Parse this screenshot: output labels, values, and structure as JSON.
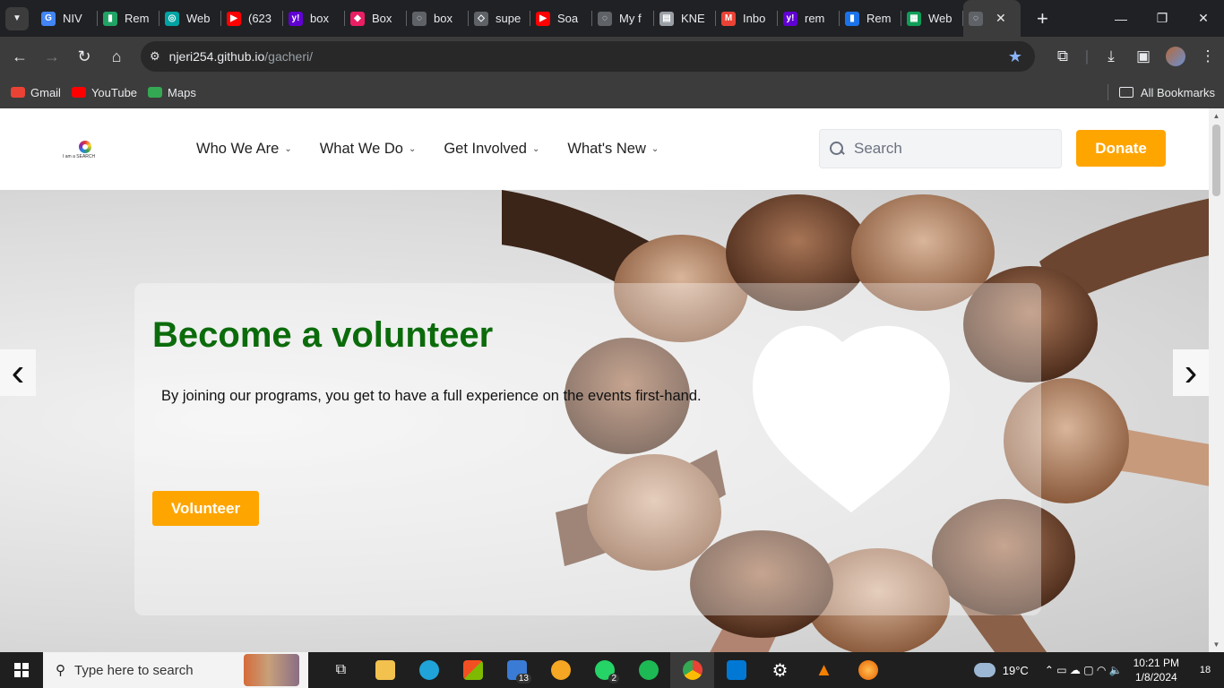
{
  "browser": {
    "tabs": [
      {
        "label": "NIV",
        "color": "#4285f4",
        "glyph": "G"
      },
      {
        "label": "Rem",
        "color": "#21a366",
        "glyph": "▮"
      },
      {
        "label": "Web",
        "color": "#00a3a3",
        "glyph": "◎"
      },
      {
        "label": "(623",
        "color": "#ff0000",
        "glyph": "▶"
      },
      {
        "label": "box",
        "color": "#6001d2",
        "glyph": "y!"
      },
      {
        "label": "Box",
        "color": "#e91e63",
        "glyph": "◆"
      },
      {
        "label": "box",
        "color": "#5f6368",
        "glyph": "◌"
      },
      {
        "label": "supe",
        "color": "#5f6368",
        "glyph": "◇"
      },
      {
        "label": "Soa",
        "color": "#ff0000",
        "glyph": "▶"
      },
      {
        "label": "My f",
        "color": "#5f6368",
        "glyph": "◌"
      },
      {
        "label": "KNE",
        "color": "#9aa0a6",
        "glyph": "▤"
      },
      {
        "label": "Inbo",
        "color": "#ea4335",
        "glyph": "M"
      },
      {
        "label": "rem",
        "color": "#6001d2",
        "glyph": "y!"
      },
      {
        "label": "Rem",
        "color": "#1a73e8",
        "glyph": "▮"
      },
      {
        "label": "Web",
        "color": "#0f9d58",
        "glyph": "▦"
      }
    ],
    "active_tab": {
      "label": "",
      "glyph": "◌"
    },
    "close_label": "✕",
    "new_tab_label": "+",
    "window_controls": {
      "minimize": "—",
      "maximize": "❐",
      "close": "✕"
    },
    "url": {
      "host": "njeri254.github.io",
      "path": "/gacheri/"
    },
    "bookmarks": [
      {
        "label": "Gmail",
        "color": "#ea4335"
      },
      {
        "label": "YouTube",
        "color": "#ff0000"
      },
      {
        "label": "Maps",
        "color": "#34a853"
      }
    ],
    "all_bookmarks_label": "All Bookmarks"
  },
  "site": {
    "logo_text": "I am a SEARCH",
    "menu": [
      {
        "label": "Who We Are"
      },
      {
        "label": "What We Do"
      },
      {
        "label": "Get Involved"
      },
      {
        "label": "What's New"
      }
    ],
    "search_placeholder": "Search",
    "donate_label": "Donate",
    "hero": {
      "title": "Become a volunteer",
      "text": "By joining our programs, you get to have a full experience on the events first-hand.",
      "button_label": "Volunteer",
      "prev_label": "‹",
      "next_label": "›"
    },
    "colors": {
      "accent": "#ffa500",
      "title_green": "#0b6b0b"
    }
  },
  "taskbar": {
    "search_placeholder": "Type here to search",
    "mail_badge": "13",
    "whatsapp_badge": "2",
    "weather": "19°C",
    "time": "10:21 PM",
    "date": "1/8/2024",
    "notification_count": "18"
  }
}
